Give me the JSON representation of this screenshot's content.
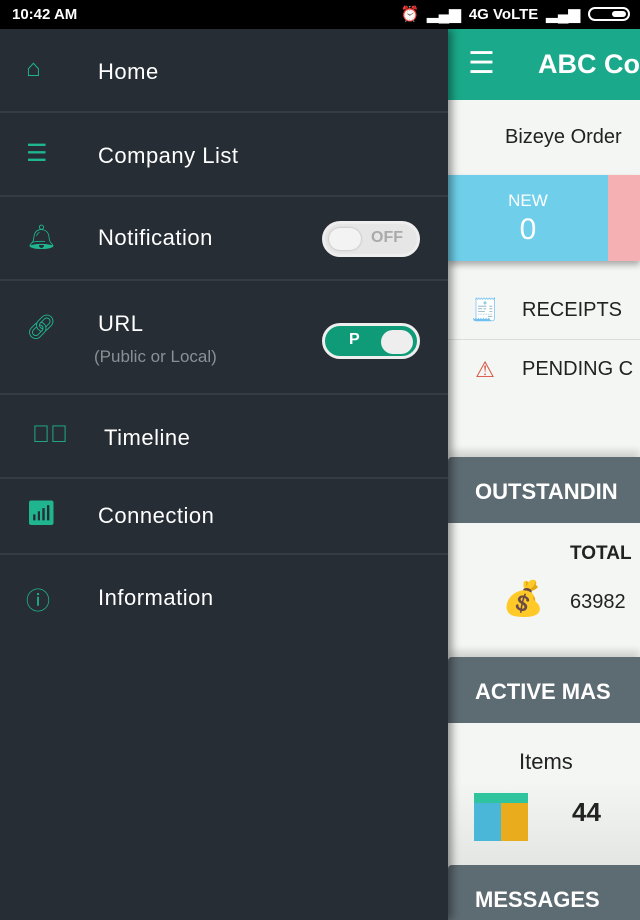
{
  "status_bar": {
    "time": "10:42 AM",
    "network": "4G VoLTE"
  },
  "app": {
    "title": "ABC Co",
    "subtitle": "Bizeye Order",
    "tiles": [
      {
        "label": "NEW",
        "value": "0"
      }
    ],
    "rows": [
      {
        "icon": "receipt-icon",
        "label": "RECEIPTS"
      },
      {
        "icon": "warning-icon",
        "label": "PENDING C"
      }
    ],
    "sections": {
      "outstanding": "OUTSTANDIN",
      "total_label": "TOTAL",
      "total_value": "63982",
      "active": "ACTIVE MAS",
      "items_label": "Items",
      "items_value": "44",
      "messages": "MESSAGES"
    }
  },
  "drawer": {
    "items": [
      {
        "label": "Home",
        "icon": "home-icon"
      },
      {
        "label": "Company List",
        "icon": "list-icon"
      },
      {
        "label": "Notification",
        "icon": "bell-icon",
        "toggle": "OFF"
      },
      {
        "label": "URL",
        "sublabel": "(Public or Local)",
        "icon": "link-icon",
        "toggle": "P"
      },
      {
        "label": "Timeline",
        "icon": "check-circle-icon"
      },
      {
        "label": "Connection",
        "icon": "wifi-icon"
      },
      {
        "label": "Information",
        "icon": "info-icon"
      }
    ]
  },
  "colors": {
    "accent": "#1aa98a",
    "drawer_bg": "#262d34",
    "tile_new": "#6fcfea",
    "tile_pink": "#f4b0b3",
    "section": "#5d6b72"
  }
}
